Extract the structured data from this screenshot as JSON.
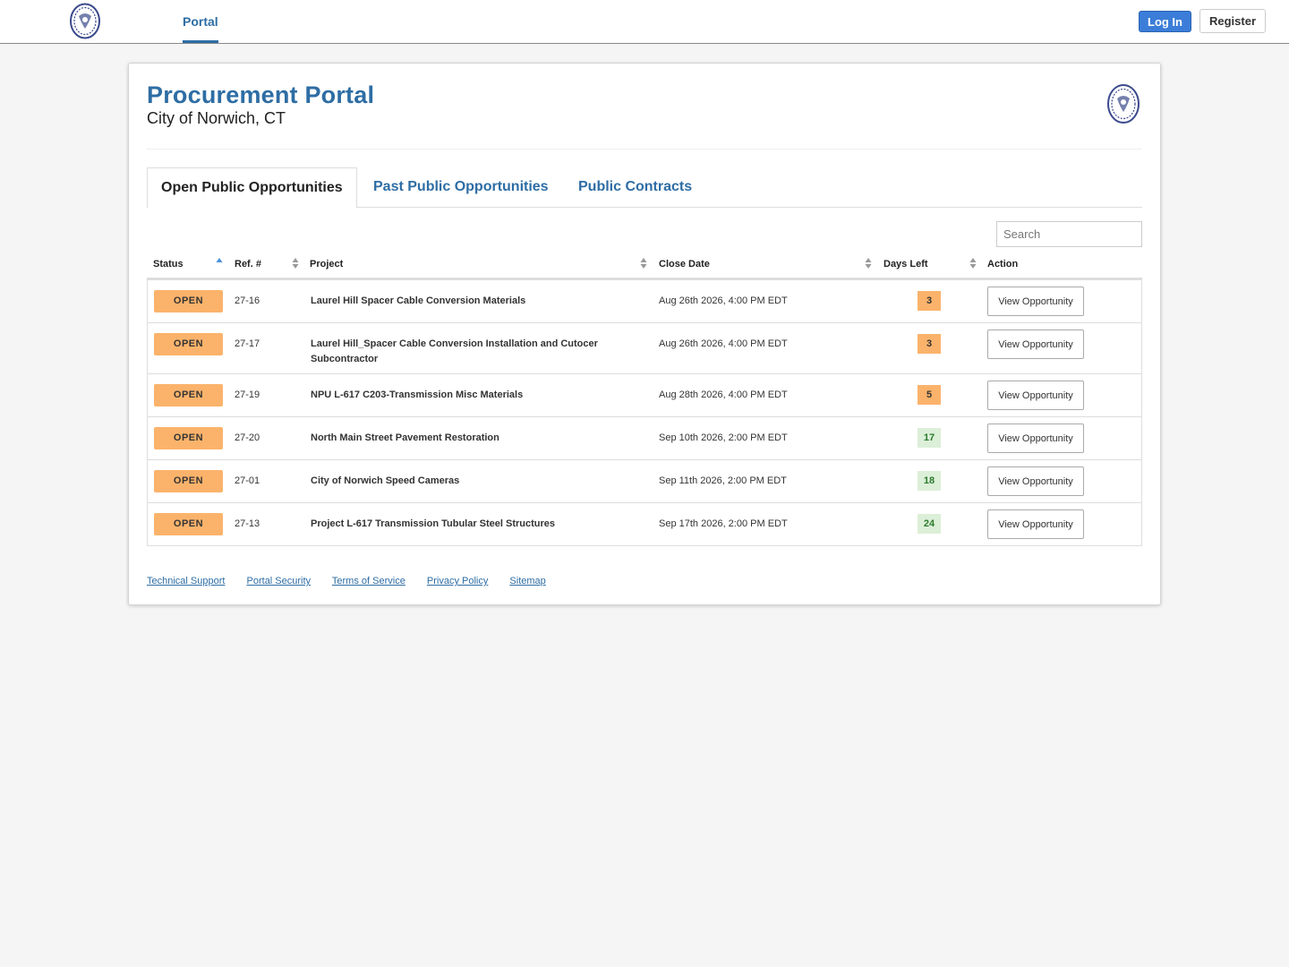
{
  "topnav": {
    "portal_label": "Portal",
    "login_label": "Log In",
    "register_label": "Register"
  },
  "header": {
    "title": "Procurement Portal",
    "subtitle": "City of Norwich, CT"
  },
  "tabs": [
    {
      "label": "Open Public Opportunities"
    },
    {
      "label": "Past Public Opportunities"
    },
    {
      "label": "Public Contracts"
    }
  ],
  "search": {
    "placeholder": "Search",
    "value": ""
  },
  "table": {
    "columns": [
      "Status",
      "Ref. #",
      "Project",
      "Close Date",
      "Days Left",
      "Action"
    ],
    "rows": [
      {
        "status": "OPEN",
        "ref": "27-16",
        "project": "Laurel Hill Spacer Cable Conversion Materials",
        "close": "Aug 26th 2026, 4:00 PM EDT",
        "days": "3",
        "action": "View Opportunity"
      },
      {
        "status": "OPEN",
        "ref": "27-17",
        "project": "Laurel Hill_Spacer Cable Conversion Installation and Cutocer Subcontractor",
        "close": "Aug 26th 2026, 4:00 PM EDT",
        "days": "3",
        "action": "View Opportunity"
      },
      {
        "status": "OPEN",
        "ref": "27-19",
        "project": "NPU L-617 C203-Transmission Misc Materials",
        "close": "Aug 28th 2026, 4:00 PM EDT",
        "days": "5",
        "action": "View Opportunity"
      },
      {
        "status": "OPEN",
        "ref": "27-20",
        "project": "North Main Street Pavement Restoration",
        "close": "Sep 10th 2026, 2:00 PM EDT",
        "days": "17",
        "action": "View Opportunity"
      },
      {
        "status": "OPEN",
        "ref": "27-01",
        "project": "City of Norwich Speed Cameras",
        "close": "Sep 11th 2026, 2:00 PM EDT",
        "days": "18",
        "action": "View Opportunity"
      },
      {
        "status": "OPEN",
        "ref": "27-13",
        "project": "Project L-617 Transmission Tubular Steel Structures",
        "close": "Sep 17th 2026, 2:00 PM EDT",
        "days": "24",
        "action": "View Opportunity"
      }
    ]
  },
  "footer": {
    "links": [
      "Technical Support",
      "Portal Security",
      "Terms of Service",
      "Privacy Policy",
      "Sitemap"
    ]
  },
  "colors": {
    "brand_blue": "#2e6da4",
    "open_badge": "#fbb36b",
    "days_ok_bg": "#dcefd8",
    "days_ok_text": "#2c7a2c"
  },
  "icons": {
    "logo": "city-seal-icon",
    "sort": "sort-icon"
  }
}
